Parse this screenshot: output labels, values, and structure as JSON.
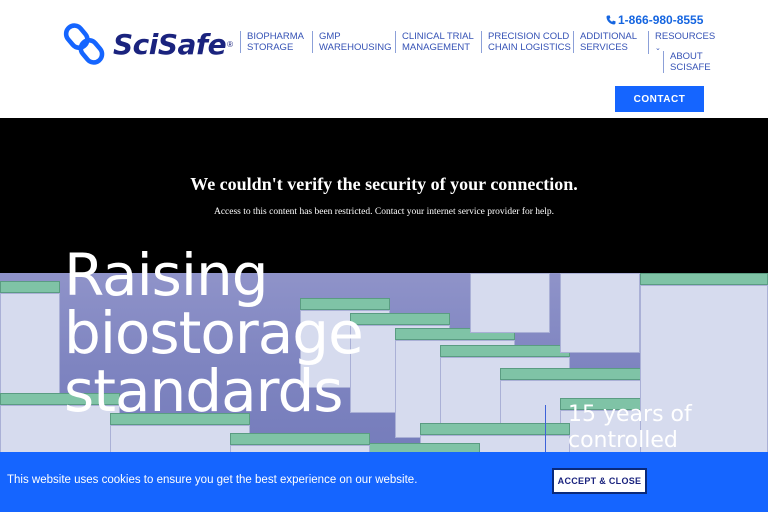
{
  "brand": {
    "name": "SciSafe",
    "reg": "®",
    "color": "#1a237e",
    "accent": "#1565ff"
  },
  "header": {
    "phone": "1-866-980-8555",
    "nav": [
      {
        "line1": "BIOPHARMA",
        "line2": "STORAGE"
      },
      {
        "line1": "GMP",
        "line2": "WAREHOUSING"
      },
      {
        "line1": "CLINICAL TRIAL",
        "line2": "MANAGEMENT"
      },
      {
        "line1": "PRECISION COLD",
        "line2": "CHAIN LOGISTICS"
      },
      {
        "line1": "ADDITIONAL",
        "line2": "SERVICES"
      },
      {
        "line1": "RESOURCES",
        "line2": ""
      },
      {
        "line1": "ABOUT",
        "line2": "SCISAFE"
      }
    ],
    "contact_label": "CONTACT"
  },
  "blocked": {
    "title": "We couldn't verify the security of your connection.",
    "subtitle": "Access to this content has been restricted. Contact your internet service provider for help."
  },
  "hero": {
    "title": "Raising\nbiostorage\nstandards",
    "subtitle": "15 years of\ncontrolled"
  },
  "cookie": {
    "text": "This website uses cookies to ensure you get the best experience on our website.",
    "button": "ACCEPT & CLOSE"
  },
  "icons": {
    "phone": "phone-icon",
    "chevron": "chevron-down-icon",
    "logo": "scisafe-logo-icon"
  }
}
